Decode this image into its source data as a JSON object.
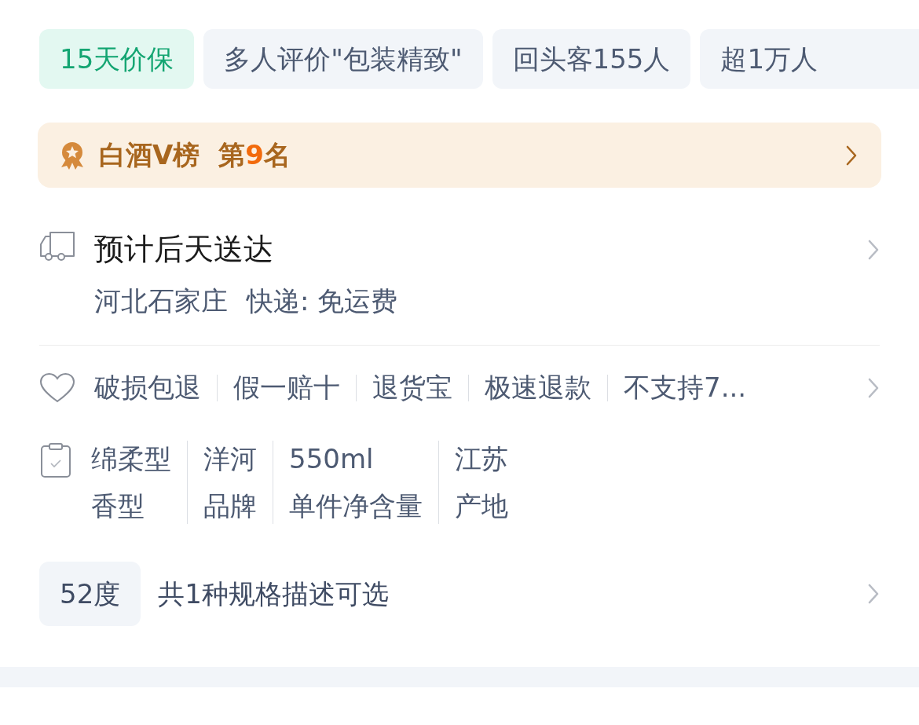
{
  "tags": [
    {
      "text": "15天价保",
      "kind": "highlight"
    },
    {
      "text": "多人评价\"包装精致\"",
      "kind": "plain"
    },
    {
      "text": "回头客155人",
      "kind": "plain"
    },
    {
      "text": "超1万人",
      "kind": "plain"
    }
  ],
  "ranking": {
    "label": "白酒V榜",
    "prefix": "第",
    "rank": "9",
    "suffix": "名"
  },
  "delivery": {
    "title": "预计后天送达",
    "location": "河北石家庄",
    "shipping": "快递: 免运费"
  },
  "guarantees": [
    "破损包退",
    "假一赔十",
    "退货宝",
    "极速退款",
    "不支持7..."
  ],
  "specs": [
    {
      "value": "绵柔型",
      "label": "香型"
    },
    {
      "value": "洋河",
      "label": "品牌"
    },
    {
      "value": "550ml",
      "label": "单件净含量"
    },
    {
      "value": "江苏",
      "label": "产地"
    }
  ],
  "variant": {
    "chip": "52度",
    "text": "共1种规格描述可选"
  }
}
